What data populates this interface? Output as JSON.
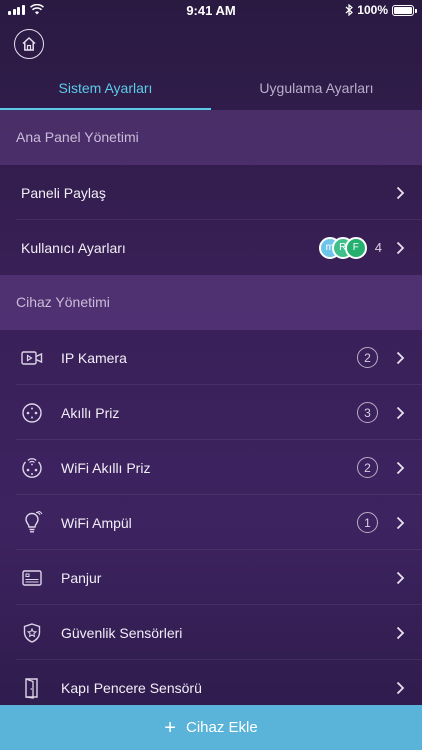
{
  "status_bar": {
    "time": "9:41 AM",
    "battery": "100%"
  },
  "tabs": [
    {
      "label": "Sistem Ayarları",
      "active": true
    },
    {
      "label": "Uygulama Ayarları",
      "active": false
    }
  ],
  "sections": {
    "panel": {
      "title": "Ana Panel Yönetimi"
    },
    "devices": {
      "title": "Cihaz Yönetimi"
    }
  },
  "panel_items": [
    {
      "label": "Paneli Paylaş"
    },
    {
      "label": "Kullanıcı Ayarları",
      "user_count": "4",
      "avatars": [
        "m",
        "R",
        "F"
      ]
    }
  ],
  "device_items": [
    {
      "label": "IP Kamera",
      "icon": "camera-icon",
      "count": "2"
    },
    {
      "label": "Akıllı Priz",
      "icon": "plug-icon",
      "count": "3"
    },
    {
      "label": "WiFi Akıllı Priz",
      "icon": "wifi-plug-icon",
      "count": "2"
    },
    {
      "label": "WiFi Ampül",
      "icon": "bulb-icon",
      "count": "1"
    },
    {
      "label": "Panjur",
      "icon": "shutter-icon"
    },
    {
      "label": "Güvenlik Sensörleri",
      "icon": "shield-star-icon"
    },
    {
      "label": "Kapı Pencere Sensörü",
      "icon": "door-icon"
    }
  ],
  "add_button": {
    "label": "Cihaz Ekle"
  },
  "colors": {
    "accent": "#5ccbe8",
    "add_button": "#5ab3d8",
    "avatar_1": "#6cc4e8",
    "avatar_2": "#3fbf8a",
    "avatar_3": "#25b070"
  }
}
